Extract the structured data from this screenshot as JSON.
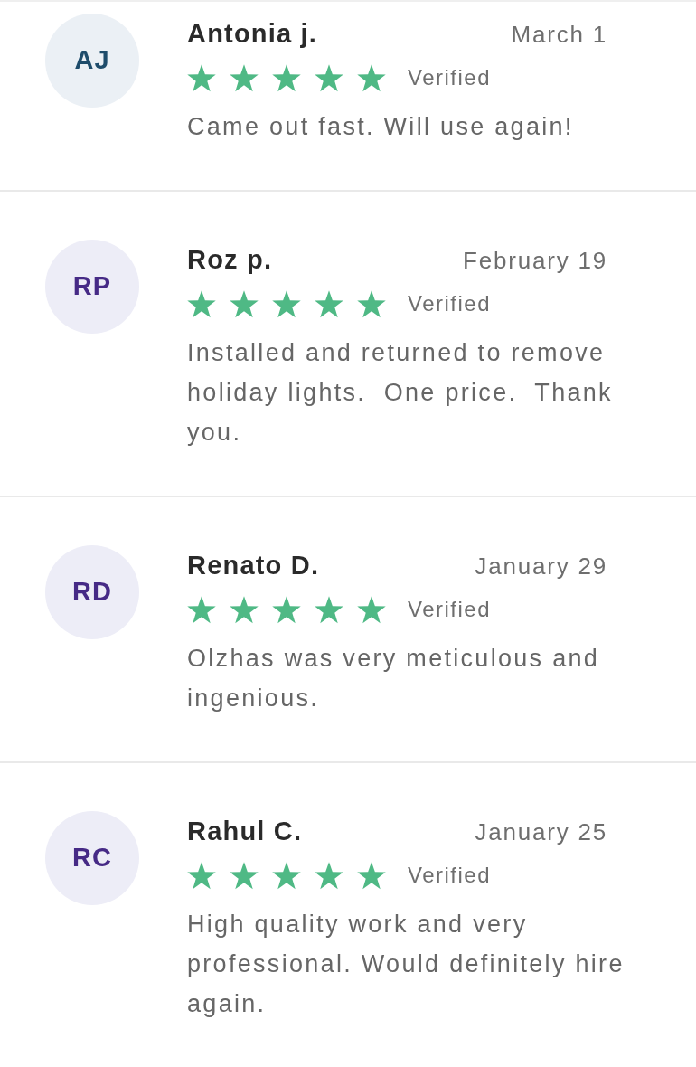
{
  "reviews": [
    {
      "avatar": {
        "initials": "AJ",
        "color": "#1e4c6b"
      },
      "name": "Antonia j.",
      "date": "March 1",
      "stars": 5,
      "badge": "Verified",
      "text": "Came out fast. Will use again!"
    },
    {
      "avatar": {
        "initials": "RP",
        "color": "#462a86"
      },
      "name": "Roz p.",
      "date": "February 19",
      "stars": 5,
      "badge": "Verified",
      "text": "Installed and returned to remove holiday lights.  One price.  Thank you."
    },
    {
      "avatar": {
        "initials": "RD",
        "color": "#462a86"
      },
      "name": "Renato D.",
      "date": "January 29",
      "stars": 5,
      "badge": "Verified",
      "text": "Olzhas was very meticulous and ingenious."
    },
    {
      "avatar": {
        "initials": "RC",
        "color": "#462a86"
      },
      "name": "Rahul C.",
      "date": "January 25",
      "stars": 5,
      "badge": "Verified",
      "text": "High quality work and very professional. Would definitely hire again."
    }
  ]
}
